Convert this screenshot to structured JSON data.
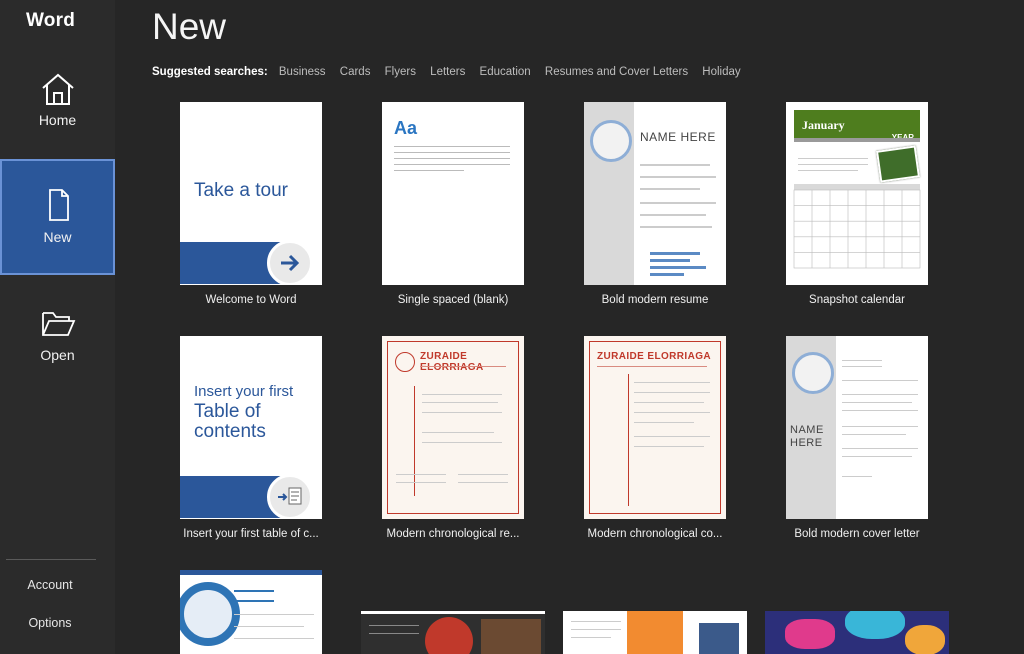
{
  "app": {
    "title": "Word"
  },
  "nav": {
    "home": "Home",
    "new": "New",
    "open": "Open",
    "account": "Account",
    "options": "Options"
  },
  "page": {
    "title": "New"
  },
  "suggested": {
    "label": "Suggested searches:",
    "items": [
      "Business",
      "Cards",
      "Flyers",
      "Letters",
      "Education",
      "Resumes and Cover Letters",
      "Holiday"
    ]
  },
  "templates": [
    {
      "label": "Welcome to Word",
      "thumb_text": "Take a tour"
    },
    {
      "label": "Single spaced (blank)",
      "thumb_text": "Aa"
    },
    {
      "label": "Bold modern resume",
      "thumb_text": "NAME HERE"
    },
    {
      "label": "Snapshot calendar",
      "thumb_text": "January",
      "thumb_sub": "YEAR"
    },
    {
      "label": "Insert your first table of c...",
      "thumb_line1": "Insert your first",
      "thumb_line2": "Table of",
      "thumb_line3": "contents"
    },
    {
      "label": "Modern chronological re...",
      "thumb_text": "ZURAIDE ELORRIAGA"
    },
    {
      "label": "Modern chronological co...",
      "thumb_text": "ZURAIDE ELORRIAGA"
    },
    {
      "label": "Bold modern cover letter",
      "thumb_text": "NAME HERE"
    }
  ],
  "colors": {
    "accent": "#2b579a",
    "sidebar": "#2b2b2b",
    "background": "#262626"
  }
}
